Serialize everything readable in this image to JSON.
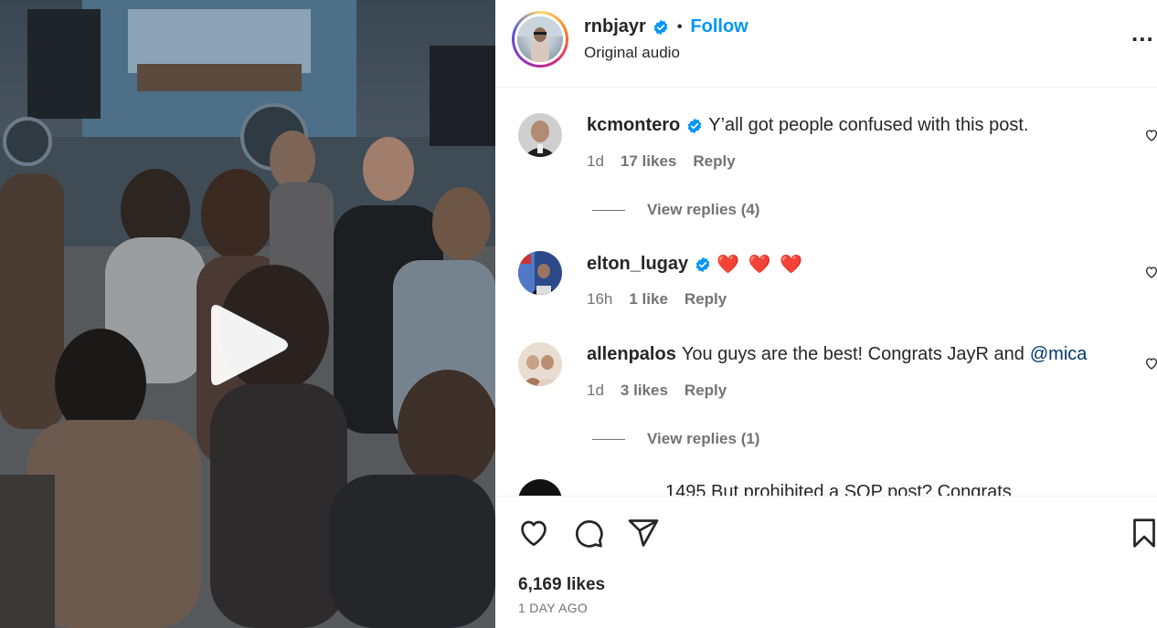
{
  "post": {
    "username": "rnbjayr",
    "separator": "•",
    "follow_label": "Follow",
    "audio": "Original audio",
    "more_label": "..."
  },
  "comments": [
    {
      "username": "kcmontero",
      "verified": true,
      "text": "Y’all got people confused with this post.",
      "time": "1d",
      "likes": "17 likes",
      "reply": "Reply",
      "view_replies": "View replies (4)"
    },
    {
      "username": "elton_lugay",
      "verified": true,
      "text": "❤️ ❤️ ❤️",
      "time": "16h",
      "likes": "1 like",
      "reply": "Reply"
    },
    {
      "username": "allenpalos",
      "verified": false,
      "text": "You guys are the best! Congrats JayR and",
      "mention": "@mica",
      "time": "1d",
      "likes": "3 likes",
      "reply": "Reply",
      "view_replies": "View replies (1)"
    },
    {
      "partial_text": "1495 But prohibited a SOP post? Congrats"
    }
  ],
  "actions": {
    "likes": "6,169 likes",
    "timestamp": "1 DAY AGO"
  },
  "icons": {
    "like": "heart-icon",
    "comment": "comment-icon",
    "share": "paper-plane-icon",
    "save": "bookmark-icon",
    "play": "play-icon",
    "verified": "verified-badge-icon"
  },
  "colors": {
    "link": "#0095f6",
    "verified": "#0095f6",
    "mention": "#00376b",
    "muted": "#737373",
    "heart_red": "#e0242c"
  }
}
